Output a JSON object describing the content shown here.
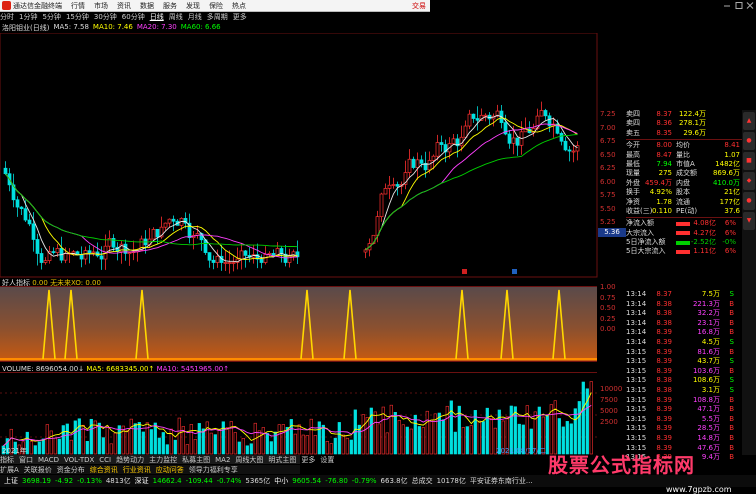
{
  "menubar": {
    "app_title": "通达信金融终端",
    "items": [
      "行情",
      "市场",
      "资讯",
      "数据",
      "服务",
      "发现",
      "保险",
      "热点"
    ],
    "right_label": "交易"
  },
  "periodbar": {
    "items": [
      "分时",
      "1分钟",
      "5分钟",
      "15分钟",
      "30分钟",
      "60分钟",
      "日线",
      "周线",
      "月线",
      "多周期",
      "更多"
    ],
    "selected": "日线"
  },
  "ma_legend": {
    "stock": "洛阳钼业(日线)",
    "ma5": "MA5: 7.58",
    "ma10": "MA10: 7.46",
    "ma20": "MA20: 7.30",
    "ma60": "MA60: 6.66"
  },
  "indicator_legend": {
    "name": "好人指标",
    "v1": "0.00",
    "v2": "无未来XO: 0.00"
  },
  "volume_legend": {
    "vol": "VOLUME: 8696054.00↓",
    "ma5": "MA5: 6683345.00↑",
    "ma10": "MA10: 5451965.00↑"
  },
  "chart_labels": {
    "date_mark": "2021/08/17/二",
    "year_mark": "2021年",
    "current_price_tag": "5.36"
  },
  "price_axis": [
    "7.25",
    "7.00",
    "6.75",
    "6.50",
    "6.25",
    "6.00",
    "5.75",
    "5.50",
    "5.25"
  ],
  "indicator_axis": [
    "1.00",
    "0.75",
    "0.50",
    "0.25",
    "0.00"
  ],
  "volume_axis": [
    "10000",
    "7500",
    "5000",
    "2500"
  ],
  "quote": {
    "asks": [
      {
        "k": "卖四",
        "p": "8.37",
        "v": "122.4万"
      },
      {
        "k": "卖四",
        "p": "8.36",
        "v": "278.1万"
      },
      {
        "k": "卖五",
        "p": "8.35",
        "v": "29.6万"
      }
    ],
    "stats": [
      {
        "k": "今开",
        "v": "8.00",
        "k2": "均价",
        "v2": "8.41"
      },
      {
        "k": "最高",
        "v": "8.47",
        "k2": "量比",
        "v2": "1.07"
      },
      {
        "k": "最低",
        "v": "7.94",
        "k2": "市值A",
        "v2": "1482亿"
      },
      {
        "k": "现量",
        "v": "275",
        "k2": "成交额",
        "v2": "869.6万"
      },
      {
        "k": "外盘",
        "v": "459.4万",
        "k2": "内盘",
        "v2": "410.0万"
      },
      {
        "k": "换手",
        "v": "4.92%",
        "k2": "股本",
        "v2": "21亿"
      },
      {
        "k": "净资",
        "v": "1.78",
        "k2": "流通",
        "v2": "177亿"
      },
      {
        "k": "收益(三)",
        "v": "0.110",
        "k2": "PE(动)",
        "v2": "37.6"
      }
    ],
    "flows": [
      {
        "k": "净流入额",
        "v": "4.08亿",
        "w": "6%"
      },
      {
        "k": "大宗流入",
        "v": "4.27亿",
        "w": "6%"
      },
      {
        "k": "5日净流入额",
        "v": "-2.52亿",
        "w": "-0%"
      },
      {
        "k": "5日大宗流入",
        "v": "1.11亿",
        "w": "6%"
      }
    ]
  },
  "ticks": [
    {
      "t": "13:14",
      "p": "8.37",
      "q": "7.5万",
      "s": "S"
    },
    {
      "t": "13:14",
      "p": "8.38",
      "q": "221.3万",
      "s": "B"
    },
    {
      "t": "13:14",
      "p": "8.38",
      "q": "32.2万",
      "s": "B"
    },
    {
      "t": "13:14",
      "p": "8.38",
      "q": "23.1万",
      "s": "B"
    },
    {
      "t": "13:14",
      "p": "8.39",
      "q": "16.8万",
      "s": "B"
    },
    {
      "t": "13:14",
      "p": "8.39",
      "q": "4.5万",
      "s": "S"
    },
    {
      "t": "13:15",
      "p": "8.39",
      "q": "81.6万",
      "s": "B"
    },
    {
      "t": "13:15",
      "p": "8.39",
      "q": "43.7万",
      "s": "S"
    },
    {
      "t": "13:15",
      "p": "8.39",
      "q": "103.6万",
      "s": "B"
    },
    {
      "t": "13:15",
      "p": "8.38",
      "q": "108.6万",
      "s": "S"
    },
    {
      "t": "13:15",
      "p": "8.38",
      "q": "3.1万",
      "s": "S"
    },
    {
      "t": "13:15",
      "p": "8.39",
      "q": "108.8万",
      "s": "B"
    },
    {
      "t": "13:15",
      "p": "8.39",
      "q": "47.1万",
      "s": "B"
    },
    {
      "t": "13:15",
      "p": "8.39",
      "q": "5.5万",
      "s": "B"
    },
    {
      "t": "13:15",
      "p": "8.39",
      "q": "28.5万",
      "s": "B"
    },
    {
      "t": "13:15",
      "p": "8.39",
      "q": "14.8万",
      "s": "B"
    },
    {
      "t": "13:15",
      "p": "8.39",
      "q": "47.6万",
      "s": "B"
    },
    {
      "t": "13:15",
      "p": "8.39",
      "q": "9.4万",
      "s": "B"
    }
  ],
  "bottom_tabs1": [
    "指标",
    "窗口",
    "MACD",
    "VOL-TDX",
    "CCI",
    "趋势动力",
    "主力监控",
    "私募主图",
    "MA2",
    "周线大图",
    "明式主图",
    "更多",
    "设置"
  ],
  "bottom_tabs2": [
    "扩展A",
    "关联报价",
    "资金分布",
    "综合资讯",
    "行业资讯",
    "应动问答",
    "领导力福利专享"
  ],
  "ticker": {
    "sh": {
      "lbl": "上证",
      "v": "3698.19",
      "d": "-4.92",
      "p": "-0.13%",
      "a": "4813亿"
    },
    "sz": {
      "lbl": "深证",
      "v": "14662.4",
      "d": "-109.44",
      "p": "-0.74%",
      "a": "5365亿"
    },
    "zx": {
      "lbl": "中小",
      "v": "9605.54",
      "d": "-76.80",
      "p": "-0.79%",
      "a": "663.8亿"
    },
    "total": "总成交",
    "amount": "10178亿",
    "news": "平安证券东南行业..."
  },
  "watermark": {
    "big": "股票公式指标网",
    "url": "www.7gpzb.com"
  },
  "colors": {
    "up": "#ff3030",
    "down": "#00e0e0",
    "ma5": "#e8e8e8",
    "ma10": "#ffff00",
    "ma20": "#ff40ff",
    "ma60": "#00d000",
    "spike": "#ffd700"
  }
}
